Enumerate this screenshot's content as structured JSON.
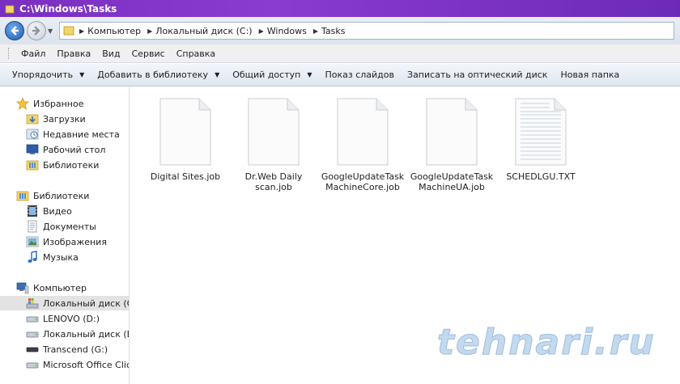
{
  "window": {
    "title": "C:\\Windows\\Tasks"
  },
  "address": {
    "crumbs": [
      "Компьютер",
      "Локальный диск (C:)",
      "Windows",
      "Tasks"
    ]
  },
  "menu": {
    "items": [
      "Файл",
      "Правка",
      "Вид",
      "Сервис",
      "Справка"
    ]
  },
  "toolbar": {
    "organize": "Упорядочить",
    "add_to_library": "Добавить в библиотеку",
    "share": "Общий доступ",
    "slideshow": "Показ слайдов",
    "burn": "Записать на оптический диск",
    "new_folder": "Новая папка"
  },
  "sidebar": {
    "favorites": {
      "label": "Избранное",
      "items": [
        "Загрузки",
        "Недавние места",
        "Рабочий стол",
        "Библиотеки"
      ]
    },
    "libraries": {
      "label": "Библиотеки",
      "items": [
        "Видео",
        "Документы",
        "Изображения",
        "Музыка"
      ]
    },
    "computer": {
      "label": "Компьютер",
      "items": [
        "Локальный диск (C:)",
        "LENOVO (D:)",
        "Локальный диск (E:)",
        "Transcend (G:)",
        "Microsoft Office Click-t"
      ]
    }
  },
  "files": [
    {
      "line1": "Digital Sites.job",
      "line2": "",
      "type": "blank"
    },
    {
      "line1": "Dr.Web Daily",
      "line2": "scan.job",
      "type": "blank"
    },
    {
      "line1": "GoogleUpdateTask",
      "line2": "MachineCore.job",
      "type": "blank"
    },
    {
      "line1": "GoogleUpdateTask",
      "line2": "MachineUA.job",
      "type": "blank"
    },
    {
      "line1": "SCHEDLGU.TXT",
      "line2": "",
      "type": "text"
    }
  ],
  "watermark": "tehnari.ru",
  "colors": {
    "titlebar": "#7a2fc0",
    "selected_row": "#e3e3e3"
  }
}
